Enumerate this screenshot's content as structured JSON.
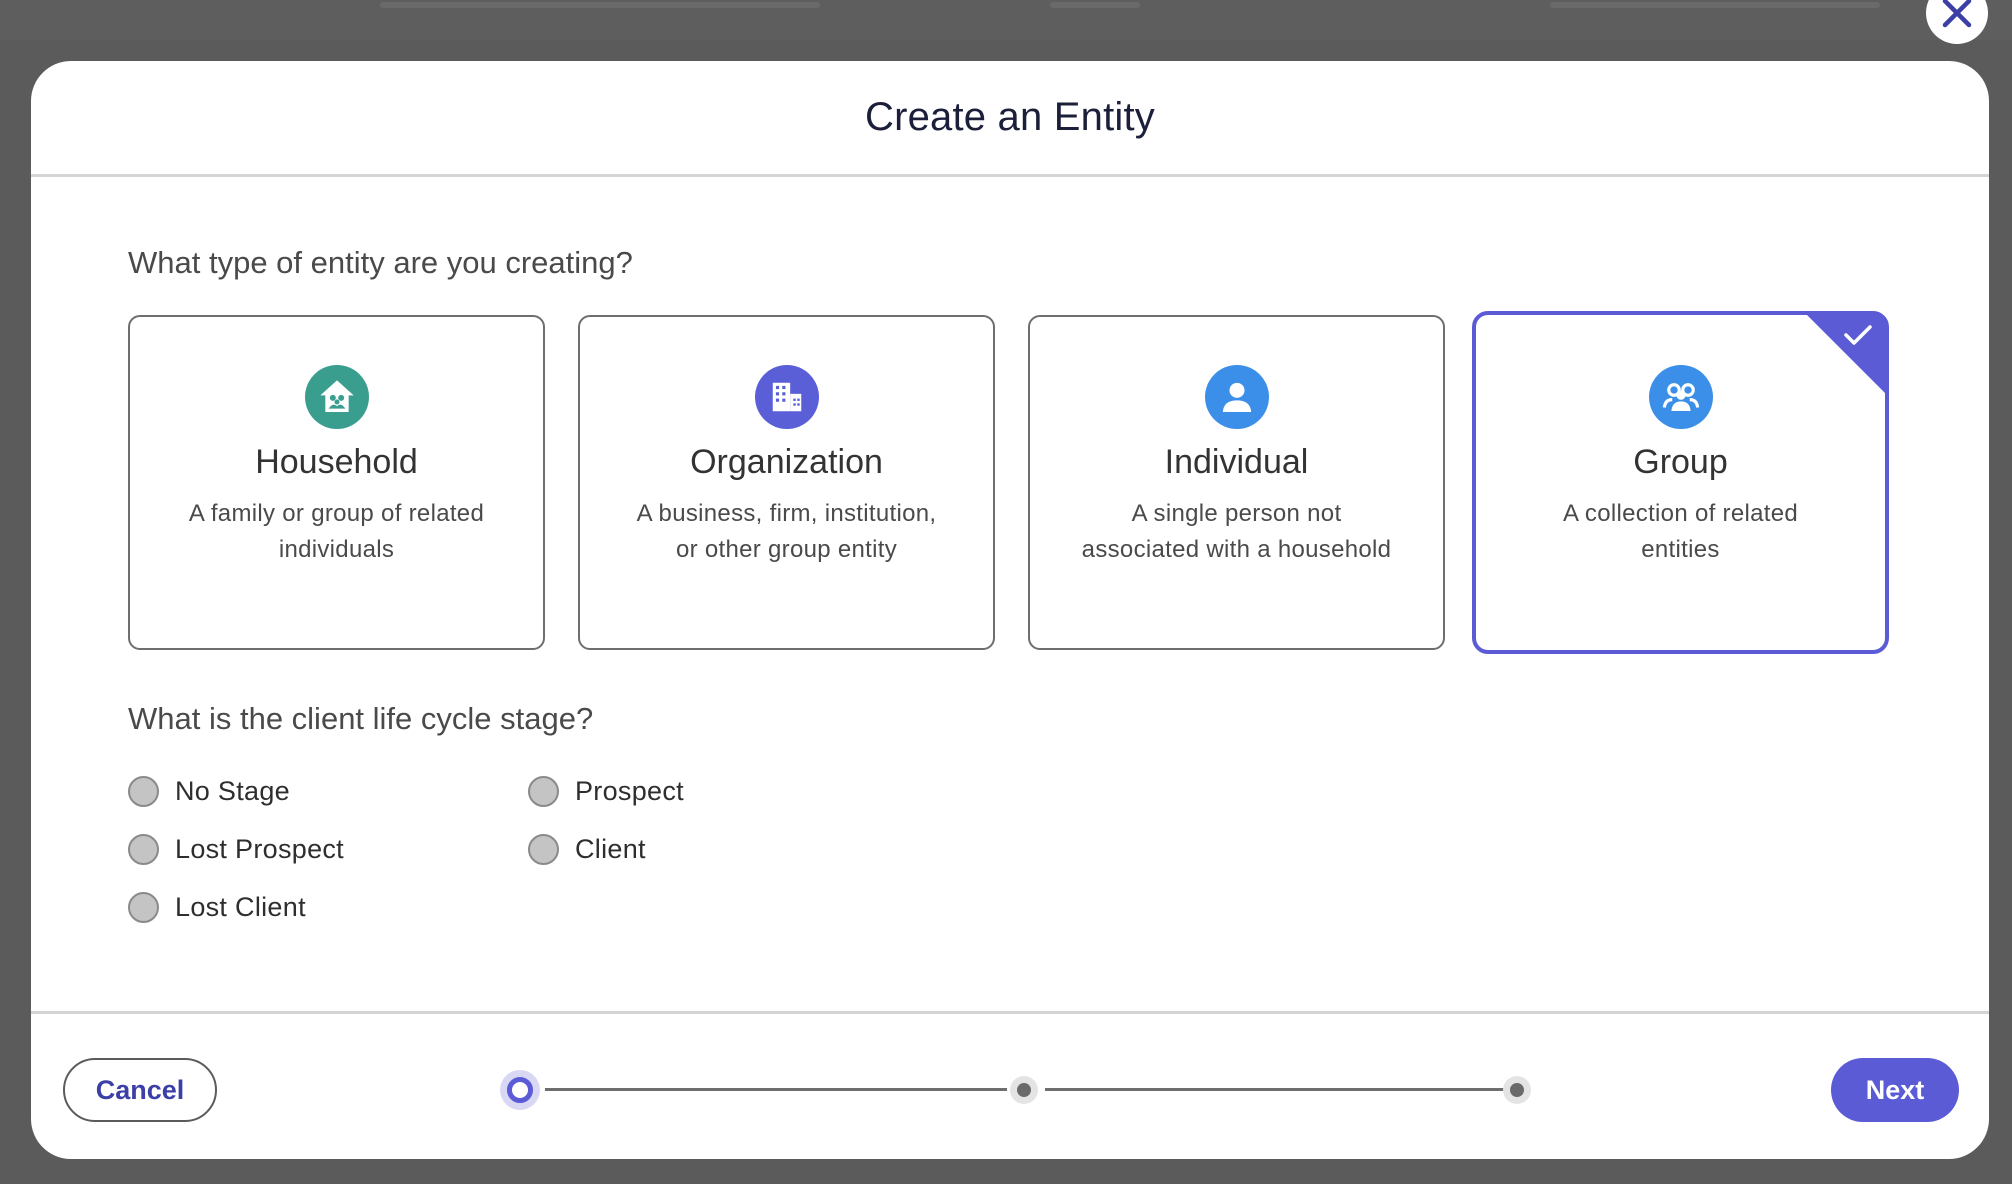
{
  "dialog": {
    "title": "Create an Entity"
  },
  "entity_question": "What type of entity are you creating?",
  "entity_types": [
    {
      "title": "Household",
      "description": "A family or group of related individuals",
      "icon": "household-icon",
      "color": "#3a9e8f",
      "selected": false
    },
    {
      "title": "Organization",
      "description": "A business, firm, institution, or other group entity",
      "icon": "building-icon",
      "color": "#5a5fd8",
      "selected": false
    },
    {
      "title": "Individual",
      "description": "A single person not associated with a household",
      "icon": "person-icon",
      "color": "#3b8fe8",
      "selected": false
    },
    {
      "title": "Group",
      "description": "A collection of related entities",
      "icon": "group-icon",
      "color": "#3b8fe8",
      "selected": true
    }
  ],
  "stage_question": "What is the client life cycle stage?",
  "stages": [
    {
      "label": "No Stage",
      "checked": false
    },
    {
      "label": "Prospect",
      "checked": false
    },
    {
      "label": "Lost Prospect",
      "checked": false
    },
    {
      "label": "Client",
      "checked": false
    },
    {
      "label": "Lost Client",
      "checked": false
    }
  ],
  "footer": {
    "cancel_label": "Cancel",
    "next_label": "Next",
    "current_step": 1,
    "total_steps": 3
  },
  "colors": {
    "accent": "#5b5bd6",
    "title_text": "#1c1f3a"
  }
}
